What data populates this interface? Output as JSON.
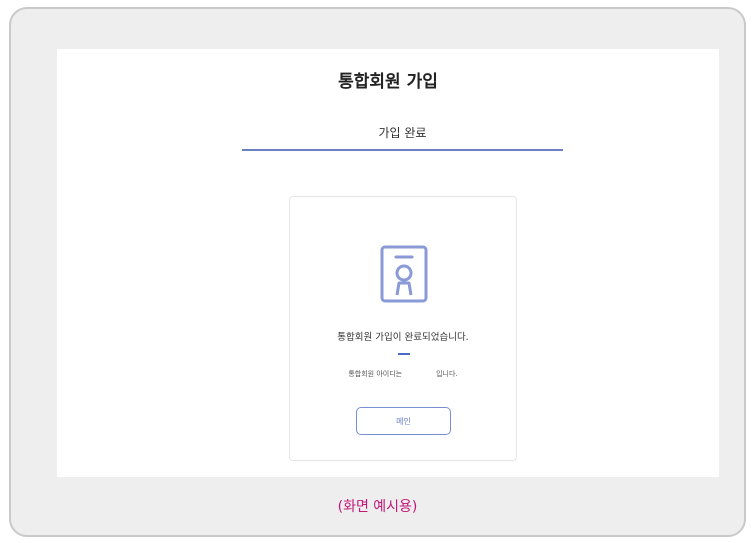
{
  "page": {
    "title": "통합회원 가입",
    "step_label": "가입 완료"
  },
  "card": {
    "icon": "id-card-icon",
    "complete_message": "통합회원 가입이 완료되었습니다.",
    "id_prefix": "통합회원 아이디는",
    "id_suffix": "입니다.",
    "main_button_label": "메인"
  },
  "caption": "(화면 예시용)",
  "colors": {
    "accent": "#6b7fc4",
    "caption": "#c2187a",
    "frame_background": "#eeeeee"
  }
}
